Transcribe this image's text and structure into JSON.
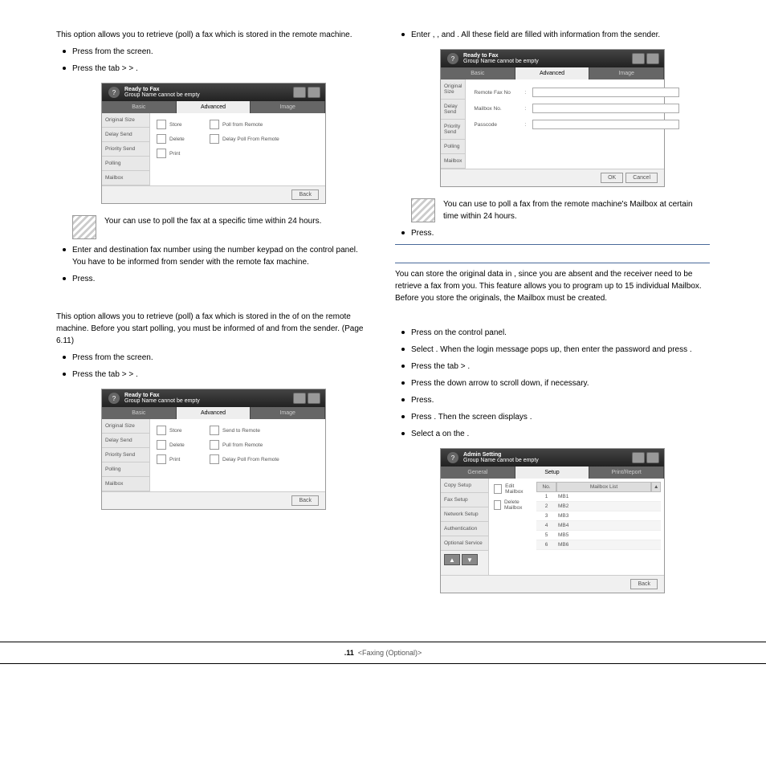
{
  "left": {
    "poll_remote": {
      "intro": "This option allows you to retrieve (poll) a fax which is stored in the remote machine.",
      "step1": {
        "a": "Press",
        "b": "from the",
        "c": "screen."
      },
      "step2": {
        "a": "Press the",
        "b": "tab >",
        "c": ">",
        "d": "."
      },
      "note": {
        "a": "Your can use",
        "b": "to poll the fax at a specific time within 24 hours."
      },
      "step3": {
        "a": "Enter",
        "b": "and destination fax number using the number keypad on the control panel. You have to be informed from sender with the remote fax machine."
      },
      "step4": {
        "a": "Press",
        "b": "."
      }
    },
    "poll_mailbox": {
      "intro": "This option allows you to retrieve (poll) a fax which is stored in the",
      "intro_b": "of on the remote machine. Before you start polling, you must be informed of",
      "intro_c": "and",
      "intro_d": "from the sender. (Page 6.11)",
      "step1": {
        "a": "Press",
        "b": "from the",
        "c": "screen."
      },
      "step2": {
        "a": "Press the",
        "b": "tab >",
        "c": ">",
        "d": "."
      }
    }
  },
  "right": {
    "enter": {
      "a": "Enter",
      "b": ",",
      "c": ", and",
      "d": ". All these field are filled with information from the sender."
    },
    "note": {
      "a": "You can use",
      "b": "to poll a fax from the remote machine's Mailbox at certain time within 24 hours."
    },
    "step_press": {
      "a": "Press",
      "b": "."
    },
    "mailbox": {
      "intro": {
        "a": "You can store the original data in",
        "b": ", since you are absent and the receiver need to be retrieve a fax from you. This feature allows you to program up to 15 individual Mailbox. Before you store the originals, the Mailbox must be created."
      },
      "step1": {
        "a": "Press",
        "b": "on the control panel."
      },
      "step2": {
        "a": "Select",
        "b": ". When the login message pops up, then enter the password and press",
        "c": "."
      },
      "step3": {
        "a": "Press the",
        "b": "tab >",
        "c": "."
      },
      "step4": "Press the down arrow to scroll down, if necessary.",
      "step5": {
        "a": "Press",
        "b": "."
      },
      "step6": {
        "a": "Press",
        "b": ". Then the screen displays",
        "c": "."
      },
      "step7": {
        "a": "Select a",
        "b": "on the",
        "c": "."
      }
    }
  },
  "ss": {
    "ready": "Ready to Fax",
    "groupname": "Group Name cannot be empty",
    "tabs": {
      "basic": "Basic",
      "advanced": "Advanced",
      "image": "Image"
    },
    "side": {
      "os": "Original Size",
      "ds": "Delay Send",
      "ps": "Priority Send",
      "po": "Polling",
      "mb": "Mailbox"
    },
    "store": "Store",
    "delete": "Delete",
    "print": "Print",
    "pollfromremote": "Poll from Remote",
    "delaypoll": "Delay Poll From Remote",
    "sendtoremote": "Send to Remote",
    "pullfromremote": "Pull from Remote",
    "back": "Back",
    "ok": "OK",
    "cancel": "Cancel",
    "remotefax": "Remote Fax No",
    "mailboxno": "Mailbox No.",
    "passcode": "Passcode",
    "admin": "Admin Setting",
    "tabs2": {
      "general": "General",
      "setup": "Setup",
      "print": "Print/Report"
    },
    "side2": {
      "cs": "Copy Setup",
      "fs": "Fax Setup",
      "ns": "Network Setup",
      "au": "Authentication",
      "os": "Optional Service"
    },
    "editmb": "Edit Mailbox",
    "delmb": "Delete Mailbox",
    "no": "No.",
    "mblist": "Mailbox List",
    "rows": [
      {
        "n": "1",
        "m": "MB1"
      },
      {
        "n": "2",
        "m": "MB2"
      },
      {
        "n": "3",
        "m": "MB3"
      },
      {
        "n": "4",
        "m": "MB4"
      },
      {
        "n": "5",
        "m": "MB5"
      },
      {
        "n": "6",
        "m": "MB6"
      }
    ]
  },
  "footer": {
    "page": ".11",
    "section": "<Faxing (Optional)>"
  }
}
